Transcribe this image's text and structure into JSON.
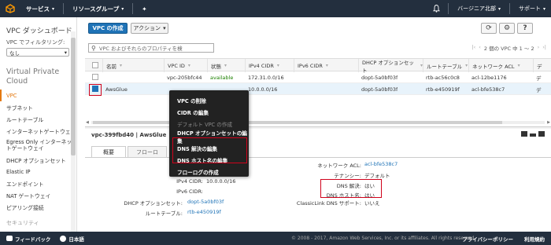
{
  "topnav": {
    "services": "サービス",
    "resource_groups": "リソースグループ",
    "region": "バージニア北部",
    "support": "サポート"
  },
  "sidebar": {
    "dashboard": "VPC ダッシュボード",
    "filter_label": "VPC でフィルタリング:",
    "filter_value": "なし",
    "group_title": "Virtual Private Cloud",
    "items": [
      {
        "label": "VPC"
      },
      {
        "label": "サブネット"
      },
      {
        "label": "ルートテーブル"
      },
      {
        "label": "インターネットゲートウェイ"
      },
      {
        "label": "Egress Only インターネットゲートウェイ"
      },
      {
        "label": "DHCP オプションセット"
      },
      {
        "label": "Elastic IP"
      },
      {
        "label": "エンドポイント"
      },
      {
        "label": "NAT ゲートウェイ"
      },
      {
        "label": "ピアリング接続"
      }
    ],
    "security": "セキュリティ"
  },
  "toolbar": {
    "create_vpc": "VPC の作成",
    "actions": "アクション"
  },
  "search": {
    "placeholder": "VPC およびそれらのプロパティを検"
  },
  "pager": {
    "text": "2 個の VPC 中 1 ～ 2"
  },
  "table": {
    "headers": [
      "名前",
      "VPC ID",
      "状態",
      "IPv4 CIDR",
      "IPv6 CIDR",
      "DHCP オプションセット",
      "ルートテーブル",
      "ネットワーク ACL",
      "デ"
    ],
    "rows": [
      {
        "name": "",
        "vpc_id": "vpc-205bfc44",
        "state": "available",
        "ipv4": "172.31.0.0/16",
        "ipv6": "",
        "dhcp": "dopt-5a0bf03f",
        "rtb": "rtb-ac56c0c8",
        "acl": "acl-12be1176",
        "d": "デ"
      },
      {
        "name": "AwsGlue",
        "vpc_id": "",
        "state": "",
        "ipv4": "10.0.0.0/16",
        "ipv6": "",
        "dhcp": "dopt-5a0bf03f",
        "rtb": "rtb-e450919f",
        "acl": "acl-bfe538c7",
        "d": "デ"
      }
    ]
  },
  "context_menu": {
    "items": [
      {
        "label": "VPC の削除"
      },
      {
        "label": "CIDR の編集"
      },
      {
        "label": "デフォルト VPC の作成"
      },
      {
        "label": "DHCP オプションセットの編集"
      },
      {
        "label": "DNS 解決の編集"
      },
      {
        "label": "DNS ホスト名の編集"
      },
      {
        "label": "フローログの作成"
      }
    ]
  },
  "detail": {
    "title": "vpc-399fbd40 | AwsGlue",
    "tabs": [
      "概要",
      "フローロ"
    ],
    "left": {
      "vpc_id_label": "VP",
      "ipv4_label": "IPv4 CIDR:",
      "ipv4_value": "10.0.0.0/16",
      "ipv6_label": "IPv6 CIDR:",
      "dhcp_label": "DHCP オプションセット:",
      "dhcp_value": "dopt-5a0bf03f",
      "rtb_label": "ルートテーブル:",
      "rtb_value": "rtb-e450919f"
    },
    "right": {
      "acl_label": "ネットワーク ACL:",
      "acl_value": "acl-bfe538c7",
      "tenancy_label": "テナンシー:",
      "tenancy_value": "デフォルト",
      "dns_res_label": "DNS 解決:",
      "dns_res_value": "はい",
      "dns_host_label": "DNS ホスト名:",
      "dns_host_value": "はい",
      "classic_label": "ClassicLink DNS サポート:",
      "classic_value": "いいえ"
    }
  },
  "footer": {
    "feedback": "フィードバック",
    "language": "日本語",
    "copyright": "© 2008 - 2017, Amazon Web Services, Inc. or its affiliates. All rights reserved.",
    "privacy": "プライバシーポリシー",
    "terms": "利用規約"
  }
}
